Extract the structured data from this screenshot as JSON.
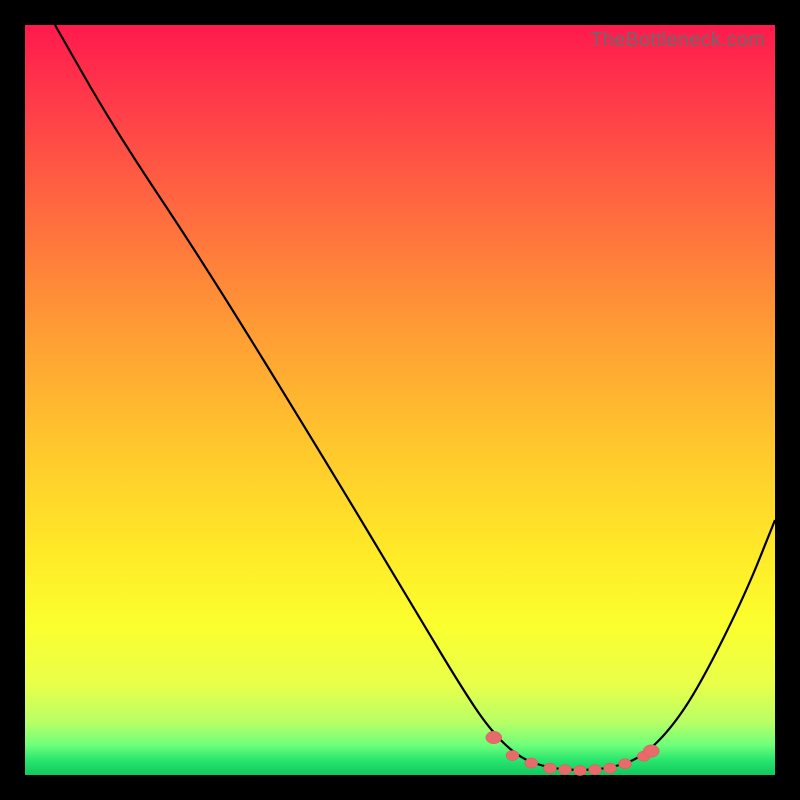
{
  "watermark": "TheBottleneck.com",
  "chart_data": {
    "type": "line",
    "title": "",
    "xlabel": "",
    "ylabel": "",
    "xlim": [
      0,
      100
    ],
    "ylim": [
      0,
      100
    ],
    "curve": [
      {
        "x": 4,
        "y": 100
      },
      {
        "x": 12,
        "y": 86
      },
      {
        "x": 24,
        "y": 68
      },
      {
        "x": 40,
        "y": 42
      },
      {
        "x": 52,
        "y": 22
      },
      {
        "x": 58,
        "y": 12
      },
      {
        "x": 62,
        "y": 6
      },
      {
        "x": 66,
        "y": 2.2
      },
      {
        "x": 70,
        "y": 0.9
      },
      {
        "x": 74,
        "y": 0.6
      },
      {
        "x": 78,
        "y": 0.9
      },
      {
        "x": 82,
        "y": 2.2
      },
      {
        "x": 86,
        "y": 6
      },
      {
        "x": 90,
        "y": 12
      },
      {
        "x": 96,
        "y": 24
      },
      {
        "x": 100,
        "y": 34
      }
    ],
    "beads": [
      {
        "x": 62.5,
        "y": 5.0
      },
      {
        "x": 65.0,
        "y": 2.6
      },
      {
        "x": 67.5,
        "y": 1.6
      },
      {
        "x": 70.0,
        "y": 0.9
      },
      {
        "x": 72.0,
        "y": 0.7
      },
      {
        "x": 74.0,
        "y": 0.6
      },
      {
        "x": 76.0,
        "y": 0.7
      },
      {
        "x": 78.0,
        "y": 0.9
      },
      {
        "x": 80.0,
        "y": 1.5
      },
      {
        "x": 82.5,
        "y": 2.5
      },
      {
        "x": 83.5,
        "y": 3.2
      }
    ],
    "bead_radius": 6.5,
    "end_bead_radius": 8
  }
}
